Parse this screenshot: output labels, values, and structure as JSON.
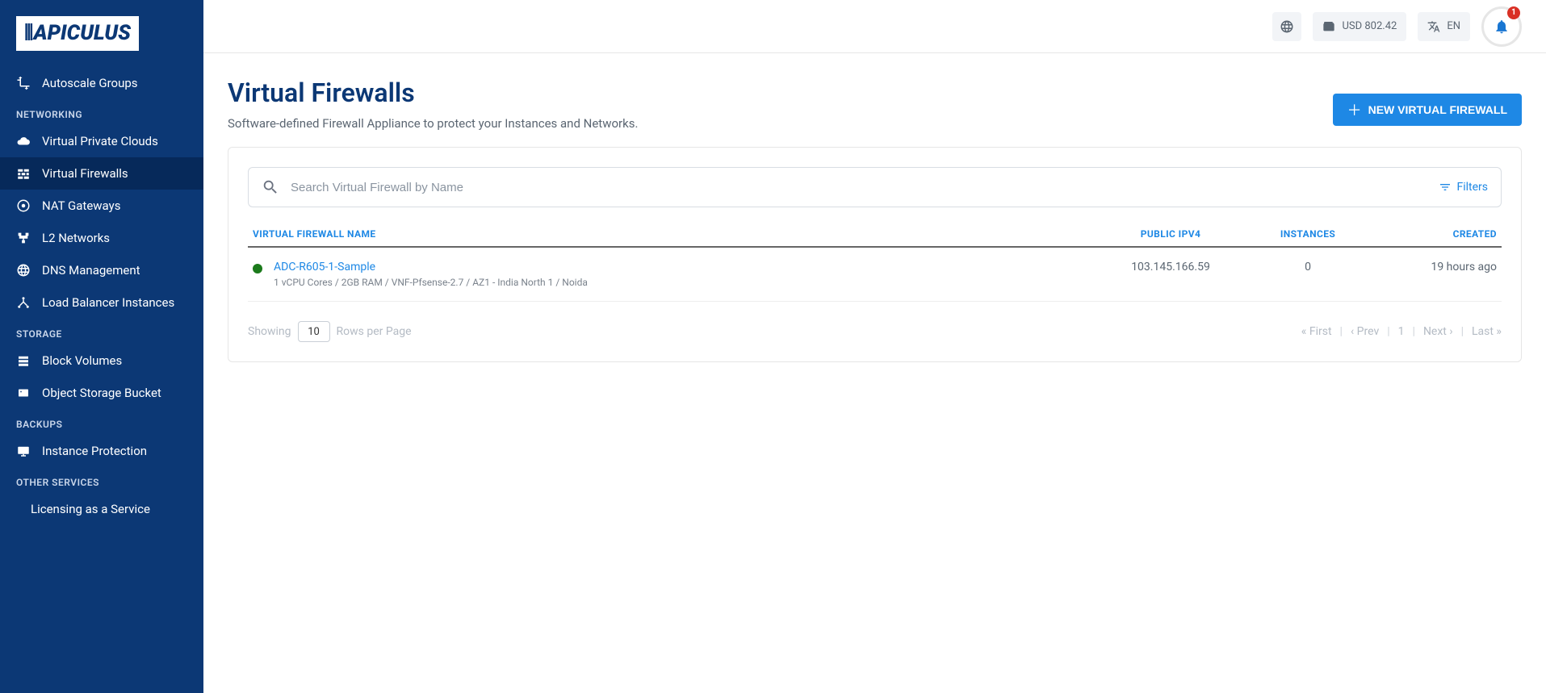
{
  "brand": {
    "name": "APICULUS"
  },
  "topbar": {
    "wallet_label": "USD 802.42",
    "lang_label": "EN",
    "notification_count": "1"
  },
  "sidebar": {
    "items_top": [
      {
        "label": "Autoscale Groups"
      }
    ],
    "groups": [
      {
        "title": "NETWORKING",
        "items": [
          {
            "label": "Virtual Private Clouds"
          },
          {
            "label": "Virtual Firewalls",
            "active": true
          },
          {
            "label": "NAT Gateways"
          },
          {
            "label": "L2 Networks"
          },
          {
            "label": "DNS Management"
          },
          {
            "label": "Load Balancer Instances"
          }
        ]
      },
      {
        "title": "STORAGE",
        "items": [
          {
            "label": "Block Volumes"
          },
          {
            "label": "Object Storage Bucket"
          }
        ]
      },
      {
        "title": "BACKUPS",
        "items": [
          {
            "label": "Instance Protection"
          }
        ]
      },
      {
        "title": "OTHER SERVICES",
        "items": [
          {
            "label": "Licensing as a Service"
          }
        ]
      }
    ]
  },
  "page": {
    "title": "Virtual Firewalls",
    "subtitle": "Software-defined Firewall Appliance to protect your Instances and Networks.",
    "new_button": "NEW VIRTUAL FIREWALL"
  },
  "search": {
    "placeholder": "Search Virtual Firewall by Name",
    "filters_label": "Filters"
  },
  "table": {
    "columns": {
      "name": "VIRTUAL FIREWALL NAME",
      "ip": "PUBLIC IPV4",
      "instances": "INSTANCES",
      "created": "CREATED"
    },
    "rows": [
      {
        "name": "ADC-R605-1-Sample",
        "sub": "1 vCPU Cores / 2GB RAM / VNF-Pfsense-2.7 / AZ1 - India North 1 / Noida",
        "ip": "103.145.166.59",
        "instances": "0",
        "created": "19 hours ago"
      }
    ]
  },
  "footer": {
    "showing_prefix": "Showing",
    "rows_value": "10",
    "rows_suffix": "Rows per Page",
    "first": "First",
    "prev": "Prev",
    "page": "1",
    "next": "Next",
    "last": "Last"
  }
}
